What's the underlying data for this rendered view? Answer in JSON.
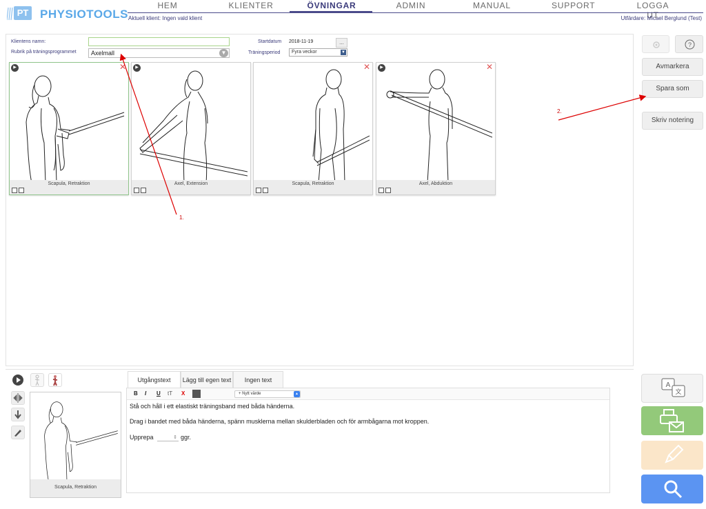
{
  "app": {
    "logo_text": "PHYSIOTOOLS",
    "logo_abbr": "PT"
  },
  "nav": {
    "items": [
      "HEM",
      "KLIENTER",
      "ÖVNINGAR",
      "ADMIN",
      "MANUAL",
      "SUPPORT",
      "LOGGA UT"
    ],
    "active": "ÖVNINGAR"
  },
  "client_info": "Aktuell klient: Ingen vald klient",
  "issuer_info": "Utfärdare: Micael Berglund (Test)",
  "form": {
    "name_label": "Klientens namn:",
    "name_value": "",
    "rubrik_label": "Rubrik på träningsprogrammet",
    "rubrik_value": "Axelmall",
    "start_label": "Startdatum",
    "start_value": "2018-11-19",
    "date_button": "...",
    "period_label": "Träningsperiod",
    "period_value": "Fyra veckor"
  },
  "exercises": [
    {
      "label": "Scapula, Retraktion",
      "selected": true
    },
    {
      "label": "Axel, Extension",
      "selected": false
    },
    {
      "label": "Scapula, Retraktion",
      "selected": false
    },
    {
      "label": "Axel, Abduktion",
      "selected": false
    }
  ],
  "sidebar": {
    "avmarkera": "Avmarkera",
    "spara_som": "Spara som",
    "skriv_notering": "Skriv notering",
    "help": "?"
  },
  "annotations": {
    "one": "1.",
    "two": "2."
  },
  "preview": {
    "label": "Scapula, Retraktion"
  },
  "tabs": [
    "Utgångstext",
    "Lägg till egen text",
    "Ingen text"
  ],
  "editor": {
    "toolbar": {
      "bold": "B",
      "italic": "I",
      "underline": "U",
      "font": "tT",
      "clear": "X"
    },
    "nytt_varde": "+ Nytt värde",
    "line1": "Stå och håll i ett elastiskt träningsband med båda händerna.",
    "line2": "Drag i bandet med båda händerna, spänn musklerna mellan skulderbladen och för armbågarna mot kroppen.",
    "upprepa": "Upprepa",
    "ggr": "ggr."
  },
  "colors": {
    "accent": "#5aa8e8",
    "nav_active": "#3a3a7a",
    "print_btn": "#93c97a",
    "edit_btn": "#fbe6c9",
    "search_btn": "#5b94f2",
    "annotation": "#dd0000"
  }
}
